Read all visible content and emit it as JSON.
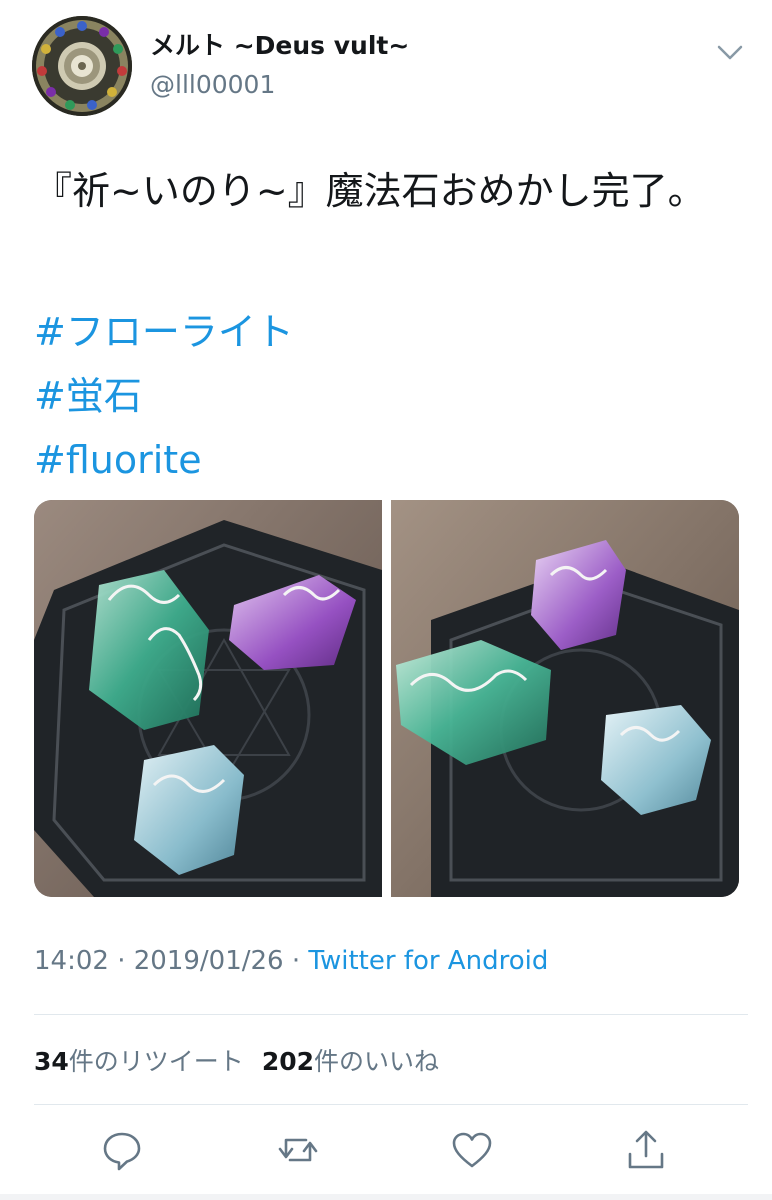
{
  "author": {
    "display_name": "メルト ~Deus vult~",
    "handle": "@lll00001",
    "avatar_icon": "jeweled-medallion-avatar"
  },
  "tweet": {
    "text": "『祈~いのり~』魔法石おめかし完了。",
    "hashtags": [
      "#フローライト",
      "#蛍石",
      "#fluorite"
    ],
    "media": [
      {
        "icon": "fluorite-crystals-photo"
      },
      {
        "icon": "fluorite-crystals-photo"
      }
    ]
  },
  "meta": {
    "time": "14:02",
    "separator": "·",
    "date": "2019/01/26",
    "source": "Twitter for Android"
  },
  "stats": {
    "retweets_count": "34",
    "retweets_label": "件のリツイート",
    "likes_count": "202",
    "likes_label": "件のいいね"
  },
  "actions": [
    {
      "name": "reply",
      "icon": "reply-icon"
    },
    {
      "name": "retweet",
      "icon": "retweet-icon"
    },
    {
      "name": "like",
      "icon": "like-icon"
    },
    {
      "name": "share",
      "icon": "share-icon"
    }
  ],
  "colors": {
    "link": "#1b95e0",
    "secondary_text": "#657786",
    "primary_text": "#14171a",
    "divider": "#e1e8ed"
  }
}
